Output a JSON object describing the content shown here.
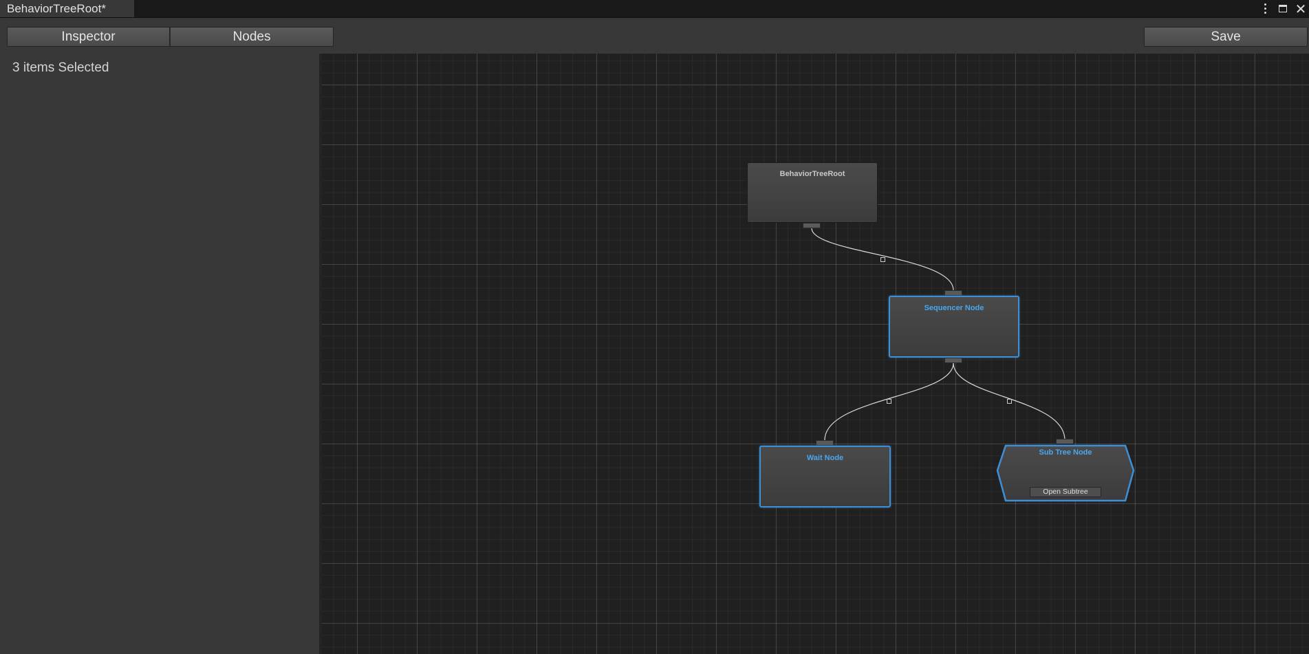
{
  "window": {
    "tab_title": "BehaviorTreeRoot*",
    "controls": [
      "kebab-menu-icon",
      "maximize-icon",
      "close-icon"
    ]
  },
  "toolbar": {
    "inspector_label": "Inspector",
    "nodes_label": "Nodes",
    "save_label": "Save"
  },
  "inspector": {
    "selection_text": "3 items Selected"
  },
  "graph": {
    "nodes": [
      {
        "id": "root",
        "title": "BehaviorTreeRoot",
        "selected": false
      },
      {
        "id": "sequencer",
        "title": "Sequencer Node",
        "selected": true
      },
      {
        "id": "wait",
        "title": "Wait Node",
        "selected": true
      },
      {
        "id": "subtree",
        "title": "Sub Tree Node",
        "selected": true,
        "button_label": "Open Subtree"
      }
    ],
    "edges": [
      {
        "from": "root",
        "to": "sequencer"
      },
      {
        "from": "sequencer",
        "to": "wait"
      },
      {
        "from": "sequencer",
        "to": "subtree"
      }
    ]
  },
  "colors": {
    "selection_accent": "#3f8fd6",
    "selected_title": "#4aa7ee",
    "panel_bg": "#383838",
    "graph_bg": "#202020"
  }
}
